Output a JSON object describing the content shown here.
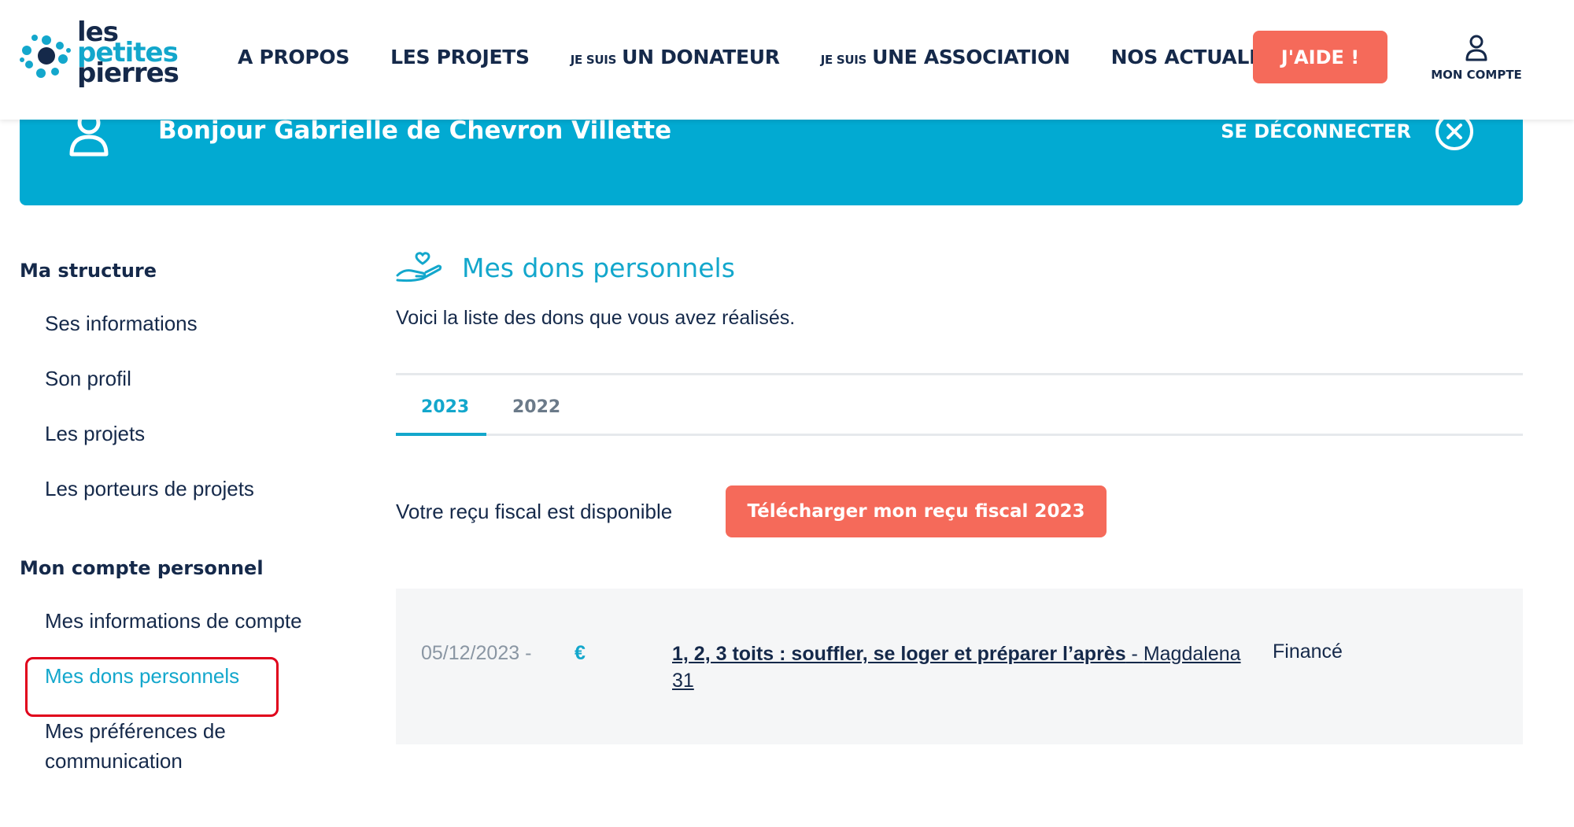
{
  "header": {
    "logo_lines": [
      "les",
      "petites",
      "pierres"
    ],
    "nav": [
      {
        "prefix": "",
        "label": "A PROPOS"
      },
      {
        "prefix": "",
        "label": "LES PROJETS"
      },
      {
        "prefix": "JE SUIS",
        "label": "UN DONATEUR"
      },
      {
        "prefix": "JE SUIS",
        "label": "UNE ASSOCIATION"
      },
      {
        "prefix": "",
        "label": "NOS ACTUALITÉS"
      }
    ],
    "cta_label": "J'AIDE !",
    "account_label": "MON COMPTE"
  },
  "banner": {
    "greeting": "Bonjour Gabrielle de Chevron Villette",
    "logout_label": "SE DÉCONNECTER"
  },
  "sidebar": {
    "sections": [
      {
        "heading": "Ma structure",
        "items": [
          "Ses informations",
          "Son profil",
          "Les projets",
          "Les porteurs de projets"
        ]
      },
      {
        "heading": "Mon compte personnel",
        "items": [
          "Mes informations de compte",
          "Mes dons personnels",
          "Mes préférences de communication"
        ]
      }
    ],
    "active_item": "Mes dons personnels"
  },
  "main": {
    "title": "Mes dons personnels",
    "intro": "Voici la liste des dons que vous avez réalisés.",
    "tabs": [
      "2023",
      "2022"
    ],
    "active_tab": "2023",
    "receipt_text": "Votre reçu fiscal est disponible",
    "receipt_button": "Télécharger mon reçu fiscal 2023",
    "donations": [
      {
        "date": "05/12/2023 -",
        "currency": "€",
        "project": "1, 2, 3 toits : souffler, se loger et préparer l’après",
        "separator": " - ",
        "owner": "Magdalena 31",
        "status": "Financé"
      }
    ]
  },
  "colors": {
    "brand_blue": "#02aad2",
    "accent_coral": "#f56a5a",
    "navy": "#15294a",
    "highlight_red": "#e0001b"
  }
}
